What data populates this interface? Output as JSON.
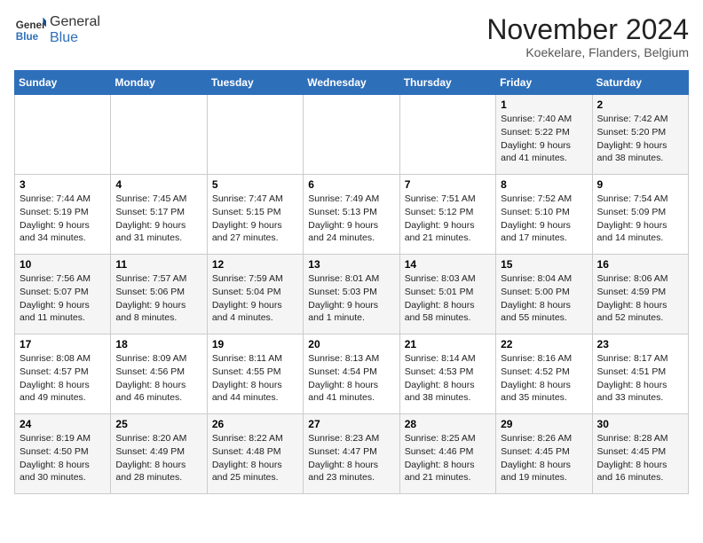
{
  "logo": {
    "general": "General",
    "blue": "Blue"
  },
  "title": "November 2024",
  "location": "Koekelare, Flanders, Belgium",
  "header": {
    "days": [
      "Sunday",
      "Monday",
      "Tuesday",
      "Wednesday",
      "Thursday",
      "Friday",
      "Saturday"
    ]
  },
  "weeks": [
    [
      {
        "day": "",
        "info": ""
      },
      {
        "day": "",
        "info": ""
      },
      {
        "day": "",
        "info": ""
      },
      {
        "day": "",
        "info": ""
      },
      {
        "day": "",
        "info": ""
      },
      {
        "day": "1",
        "info": "Sunrise: 7:40 AM\nSunset: 5:22 PM\nDaylight: 9 hours\nand 41 minutes."
      },
      {
        "day": "2",
        "info": "Sunrise: 7:42 AM\nSunset: 5:20 PM\nDaylight: 9 hours\nand 38 minutes."
      }
    ],
    [
      {
        "day": "3",
        "info": "Sunrise: 7:44 AM\nSunset: 5:19 PM\nDaylight: 9 hours\nand 34 minutes."
      },
      {
        "day": "4",
        "info": "Sunrise: 7:45 AM\nSunset: 5:17 PM\nDaylight: 9 hours\nand 31 minutes."
      },
      {
        "day": "5",
        "info": "Sunrise: 7:47 AM\nSunset: 5:15 PM\nDaylight: 9 hours\nand 27 minutes."
      },
      {
        "day": "6",
        "info": "Sunrise: 7:49 AM\nSunset: 5:13 PM\nDaylight: 9 hours\nand 24 minutes."
      },
      {
        "day": "7",
        "info": "Sunrise: 7:51 AM\nSunset: 5:12 PM\nDaylight: 9 hours\nand 21 minutes."
      },
      {
        "day": "8",
        "info": "Sunrise: 7:52 AM\nSunset: 5:10 PM\nDaylight: 9 hours\nand 17 minutes."
      },
      {
        "day": "9",
        "info": "Sunrise: 7:54 AM\nSunset: 5:09 PM\nDaylight: 9 hours\nand 14 minutes."
      }
    ],
    [
      {
        "day": "10",
        "info": "Sunrise: 7:56 AM\nSunset: 5:07 PM\nDaylight: 9 hours\nand 11 minutes."
      },
      {
        "day": "11",
        "info": "Sunrise: 7:57 AM\nSunset: 5:06 PM\nDaylight: 9 hours\nand 8 minutes."
      },
      {
        "day": "12",
        "info": "Sunrise: 7:59 AM\nSunset: 5:04 PM\nDaylight: 9 hours\nand 4 minutes."
      },
      {
        "day": "13",
        "info": "Sunrise: 8:01 AM\nSunset: 5:03 PM\nDaylight: 9 hours\nand 1 minute."
      },
      {
        "day": "14",
        "info": "Sunrise: 8:03 AM\nSunset: 5:01 PM\nDaylight: 8 hours\nand 58 minutes."
      },
      {
        "day": "15",
        "info": "Sunrise: 8:04 AM\nSunset: 5:00 PM\nDaylight: 8 hours\nand 55 minutes."
      },
      {
        "day": "16",
        "info": "Sunrise: 8:06 AM\nSunset: 4:59 PM\nDaylight: 8 hours\nand 52 minutes."
      }
    ],
    [
      {
        "day": "17",
        "info": "Sunrise: 8:08 AM\nSunset: 4:57 PM\nDaylight: 8 hours\nand 49 minutes."
      },
      {
        "day": "18",
        "info": "Sunrise: 8:09 AM\nSunset: 4:56 PM\nDaylight: 8 hours\nand 46 minutes."
      },
      {
        "day": "19",
        "info": "Sunrise: 8:11 AM\nSunset: 4:55 PM\nDaylight: 8 hours\nand 44 minutes."
      },
      {
        "day": "20",
        "info": "Sunrise: 8:13 AM\nSunset: 4:54 PM\nDaylight: 8 hours\nand 41 minutes."
      },
      {
        "day": "21",
        "info": "Sunrise: 8:14 AM\nSunset: 4:53 PM\nDaylight: 8 hours\nand 38 minutes."
      },
      {
        "day": "22",
        "info": "Sunrise: 8:16 AM\nSunset: 4:52 PM\nDaylight: 8 hours\nand 35 minutes."
      },
      {
        "day": "23",
        "info": "Sunrise: 8:17 AM\nSunset: 4:51 PM\nDaylight: 8 hours\nand 33 minutes."
      }
    ],
    [
      {
        "day": "24",
        "info": "Sunrise: 8:19 AM\nSunset: 4:50 PM\nDaylight: 8 hours\nand 30 minutes."
      },
      {
        "day": "25",
        "info": "Sunrise: 8:20 AM\nSunset: 4:49 PM\nDaylight: 8 hours\nand 28 minutes."
      },
      {
        "day": "26",
        "info": "Sunrise: 8:22 AM\nSunset: 4:48 PM\nDaylight: 8 hours\nand 25 minutes."
      },
      {
        "day": "27",
        "info": "Sunrise: 8:23 AM\nSunset: 4:47 PM\nDaylight: 8 hours\nand 23 minutes."
      },
      {
        "day": "28",
        "info": "Sunrise: 8:25 AM\nSunset: 4:46 PM\nDaylight: 8 hours\nand 21 minutes."
      },
      {
        "day": "29",
        "info": "Sunrise: 8:26 AM\nSunset: 4:45 PM\nDaylight: 8 hours\nand 19 minutes."
      },
      {
        "day": "30",
        "info": "Sunrise: 8:28 AM\nSunset: 4:45 PM\nDaylight: 8 hours\nand 16 minutes."
      }
    ]
  ]
}
